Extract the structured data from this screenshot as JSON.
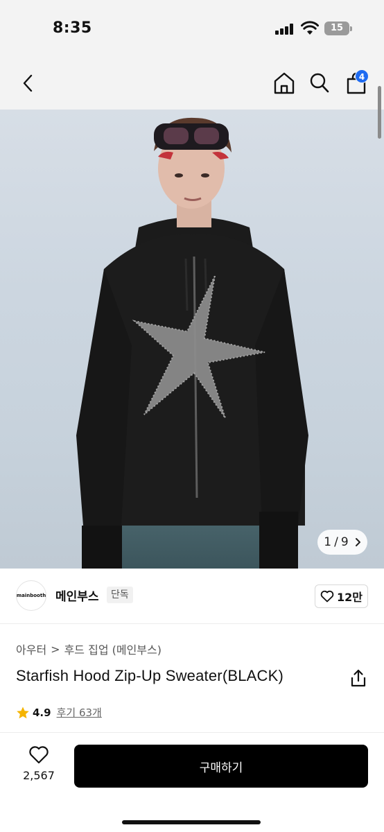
{
  "status_bar": {
    "time": "8:35",
    "battery_level": "15"
  },
  "nav": {
    "back_icon": "chevron-left-icon",
    "home_icon": "home-icon",
    "search_icon": "search-icon",
    "cart_icon": "shopping-bag-icon",
    "cart_count": "4"
  },
  "gallery": {
    "current": "1",
    "separator": "/",
    "total": "9",
    "next_icon": "chevron-right-icon"
  },
  "brand": {
    "logo_text": "mainbooth",
    "name": "메인부스",
    "tag": "단독",
    "likes": "12만"
  },
  "breadcrumb": {
    "category": "아우터",
    "separator": ">",
    "subcategory": "후드 집업 (메인부스)"
  },
  "product": {
    "title": "Starfish Hood Zip-Up Sweater(BLACK)",
    "rating": "4.9",
    "reviews": "후기 63개"
  },
  "bottom_bar": {
    "wish_count": "2,567",
    "buy_label": "구매하기"
  },
  "colors": {
    "accent_badge": "#1e6bf1",
    "star": "#f5b400",
    "buy_button": "#000000"
  }
}
